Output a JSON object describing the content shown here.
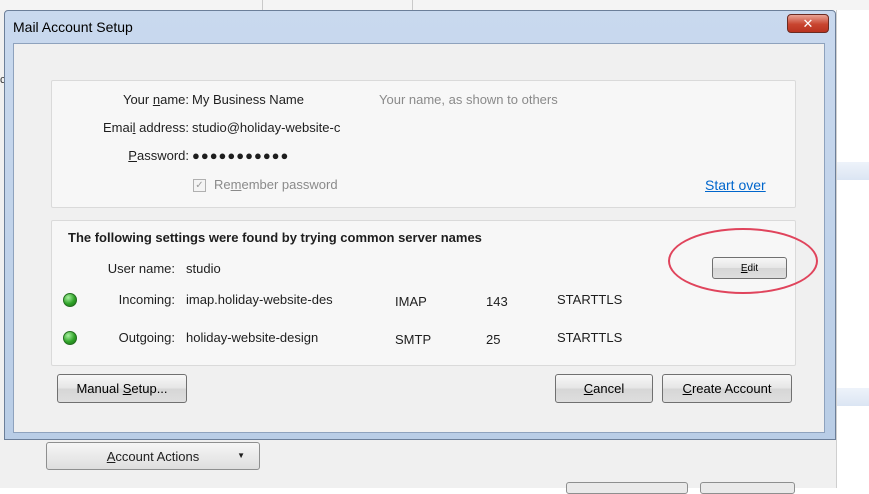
{
  "background_window": {
    "account_actions_label": "Account Actions",
    "account_actions_mnemonic_index": 0,
    "clipped_text": "c"
  },
  "dialog": {
    "title": "Mail Account Setup",
    "close_glyph": "✕",
    "identity": {
      "name_label": "Your name:",
      "name_value": "My Business Name",
      "name_hint": "Your name, as shown to others",
      "email_label": "Email address:",
      "email_value": "studio@holiday-website-c",
      "password_label": "Password:",
      "password_value": "●●●●●●●●●●●",
      "remember_label": "Remember password",
      "remember_checked": true,
      "start_over_label": "Start over"
    },
    "settings": {
      "heading": "The following settings were found by trying common server names",
      "username_label": "User name:",
      "username_value": "studio",
      "edit_label": "Edit",
      "incoming": {
        "label": "Incoming:",
        "server": "imap.holiday-website-des",
        "protocol": "IMAP",
        "port": "143",
        "security": "STARTTLS",
        "status_color": "#2fa328"
      },
      "outgoing": {
        "label": "Outgoing:",
        "server": "holiday-website-design",
        "protocol": "SMTP",
        "port": "25",
        "security": "STARTTLS",
        "status_color": "#2fa328"
      }
    },
    "buttons": {
      "manual_setup": "Manual Setup...",
      "cancel": "Cancel",
      "create_account": "Create Account"
    }
  },
  "colors": {
    "link": "#0066cc",
    "annotation": "#e0445c",
    "close_button": "#c8442f"
  }
}
